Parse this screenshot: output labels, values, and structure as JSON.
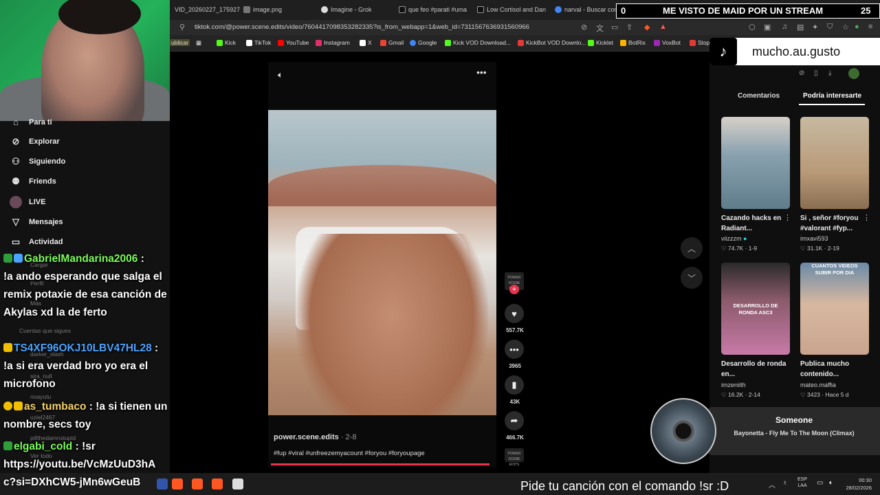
{
  "browser": {
    "tabs": [
      {
        "label": "VID_20260227_175927",
        "color": "#777"
      },
      {
        "label": "image.png",
        "color": "#777"
      },
      {
        "label": "Imagine - Grok",
        "color": "#ddd"
      },
      {
        "label": "que feo #parati #uma",
        "color": "#111"
      },
      {
        "label": "Low Cortisol and Danc",
        "color": "#111"
      },
      {
        "label": "narval - Buscar con G",
        "color": "#4285f4"
      }
    ],
    "url": "tiktok.com/@power.scene.edits/video/7604417098353282335?is_from_webapp=1&web_id=7311567636931560966",
    "bookmarks": [
      {
        "label": "Kick",
        "color": "#53fc18"
      },
      {
        "label": "TikTok",
        "color": "#ffffff"
      },
      {
        "label": "YouTube",
        "color": "#ff0000"
      },
      {
        "label": "Instagram",
        "color": "#e1306c"
      },
      {
        "label": "X",
        "color": "#ffffff"
      },
      {
        "label": "Gmail",
        "color": "#ea4335"
      },
      {
        "label": "Google",
        "color": "#4285f4"
      },
      {
        "label": "Kick VOD Download...",
        "color": "#53fc18"
      },
      {
        "label": "KickBot VOD Downlo...",
        "color": "#e53935"
      },
      {
        "label": "Kicklet",
        "color": "#53fc18"
      },
      {
        "label": "BotRix",
        "color": "#ffb300"
      },
      {
        "label": "VoxBot",
        "color": "#9c27b0"
      },
      {
        "label": "Stop",
        "color": "#e53935"
      }
    ],
    "bookmark_partial": "ublicar"
  },
  "sidebar": {
    "items": [
      {
        "label": "Para ti",
        "icon": "home-icon"
      },
      {
        "label": "Explorar",
        "icon": "compass-icon"
      },
      {
        "label": "Siguiendo",
        "icon": "following-icon"
      },
      {
        "label": "Friends",
        "icon": "friends-icon"
      },
      {
        "label": "LIVE",
        "icon": "live-icon"
      },
      {
        "label": "Mensajes",
        "icon": "messages-icon"
      },
      {
        "label": "Actividad",
        "icon": "activity-icon"
      }
    ],
    "ghost_items": [
      "Cargar",
      "Perfil",
      "Más",
      "Cuentas que sigues",
      "darker_slash",
      "sira_null",
      "noayutu",
      "uziel2467",
      "pillthedamnstupid",
      "Ver todo"
    ]
  },
  "chat": [
    {
      "user": "GabrielMandarina2006",
      "user_color": "#7cfc5a",
      "badges": [
        "#2e9e3a",
        "#4aa3ff"
      ],
      "message": "!a ando esperando que salga el remix potaxie de esa canción de Akylas xd la de ferto"
    },
    {
      "user": "TS4XF96OKJ10LBV47HL28",
      "user_color": "#4aa3ff",
      "badges": [
        "#f0c000"
      ],
      "message": "!a si era verdad bro yo era el microfono"
    },
    {
      "user": "as_tumbaco",
      "user_color": "#f5d36b",
      "badges": [
        "#f0c000",
        "#f0c000"
      ],
      "message": "!a si tienen un nombre, secs toy"
    },
    {
      "user": "elgabi_cold",
      "user_color": "#7cfc5a",
      "badges": [
        "#2e9e3a"
      ],
      "message": "!sr https://youtu.be/VcMzUuD3hA"
    }
  ],
  "chat_overflow": "c?si=DXhCW5-jMn6wGeuB",
  "video": {
    "author": "power.scene.edits",
    "date": "2-8",
    "hashtags": "#fup #viral #unfreezemyacount #foryou #foryoupage",
    "likes": "557.7K",
    "comments": "3965",
    "saves": "43K",
    "shares": "466.7K",
    "avatar_text": "POWER SCENE EDITS",
    "progress": 0.98
  },
  "stream_overlay": {
    "left_count": "0",
    "message": "ME VISTO DE MAID POR UN STREAM",
    "right_count": "25",
    "tiktok_handle": "mucho.au.gusto"
  },
  "right_panel": {
    "tabs": [
      "Comentarios",
      "Podría interesarte"
    ],
    "active_tab": 1,
    "videos": [
      {
        "title": "Cazando hacks en Radiant...",
        "author": "viizzzm",
        "verified": true,
        "likes": "74.7K",
        "date": "1-9",
        "thumb": "#5f7c8a"
      },
      {
        "title": "Si , señor #foryou #valorant #fyp...",
        "author": "imxavi593",
        "verified": false,
        "likes": "31.1K",
        "date": "2-19",
        "thumb": "#b89a78"
      },
      {
        "title": "Desarrollo de ronda en...",
        "author": "imzeniith",
        "verified": false,
        "likes": "16.2K",
        "date": "2-14",
        "thumb": "#8a5a6a",
        "overlay": "DESARROLLO DE RONDA ASC3"
      },
      {
        "title": "Publica mucho contenido...",
        "author": "mateo.maffia",
        "verified": false,
        "likes": "3423",
        "date": "Hace 5 d",
        "thumb": "#c9a48e",
        "overlay": "CUANTOS VIDEOS SUBIR POR DIA"
      }
    ]
  },
  "now_playing": {
    "label": "Someone",
    "song": "Bayonetta - Fly Me To The Moon (Climax)"
  },
  "ticker": "Pide tu canción con el comando !sr :D",
  "tray": {
    "lang_top": "ESP",
    "lang_bottom": "LAA",
    "time": "00:30",
    "date": "28/02/2026"
  }
}
